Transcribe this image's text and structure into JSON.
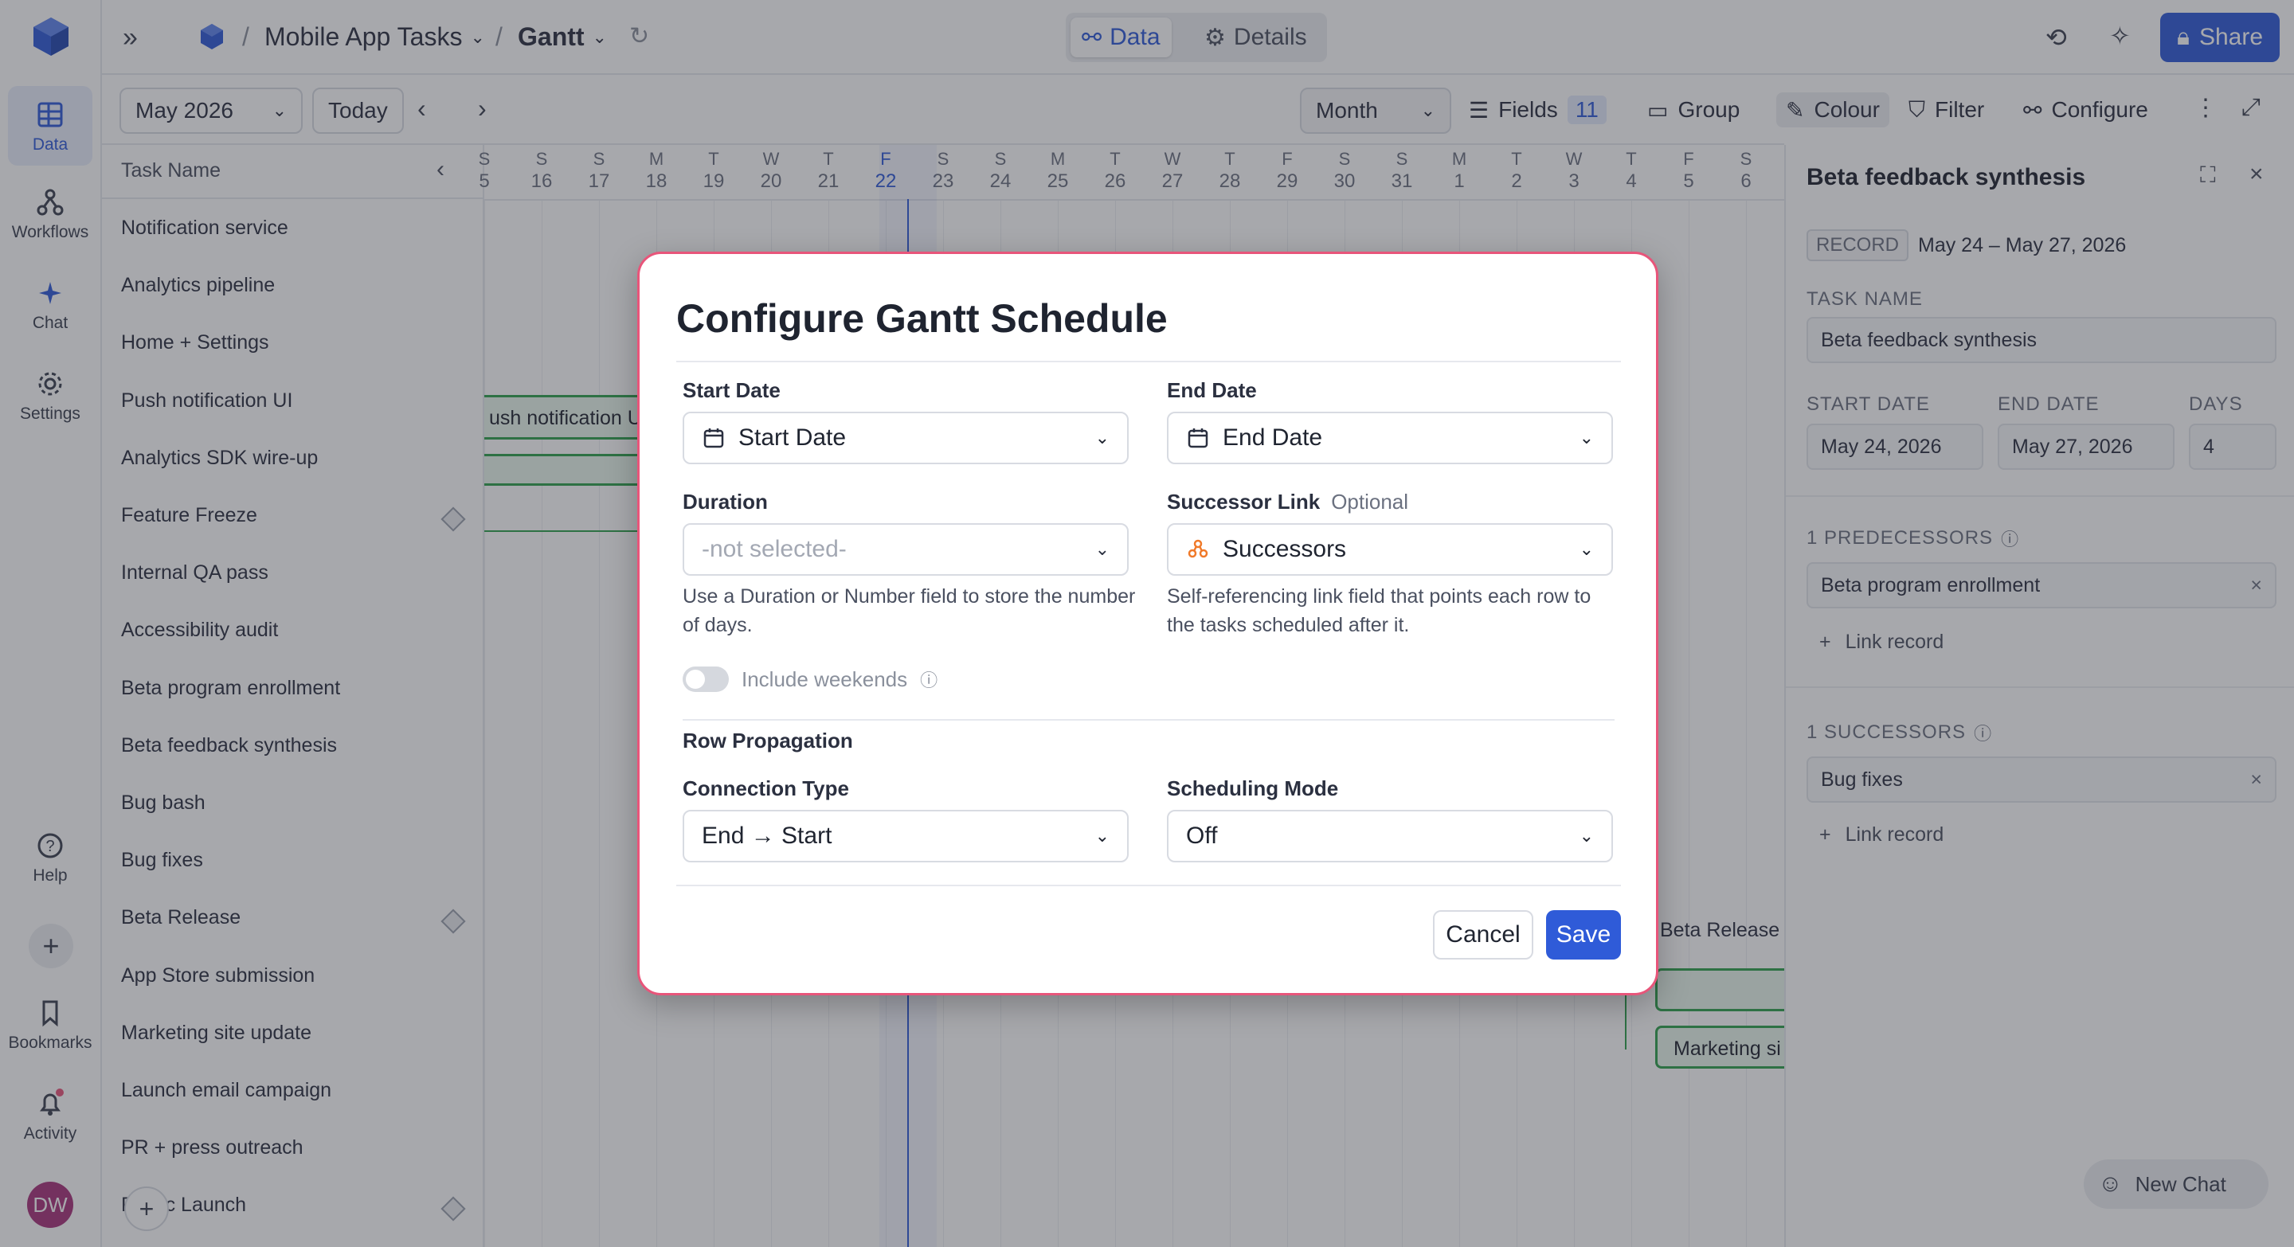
{
  "rail": {
    "items": [
      {
        "label": "Data",
        "icon": "grid-icon"
      },
      {
        "label": "Workflows",
        "icon": "workflow-icon"
      },
      {
        "label": "Chat",
        "icon": "sparkle-icon"
      },
      {
        "label": "Settings",
        "icon": "gear-icon"
      },
      {
        "label": "Help",
        "icon": "help-icon"
      },
      {
        "label": "Bookmarks",
        "icon": "bookmark-icon"
      },
      {
        "label": "Activity",
        "icon": "bell-icon"
      }
    ],
    "avatar": "DW"
  },
  "header": {
    "base_name": "Mobile App Tasks",
    "view_name": "Gantt",
    "tabs": [
      "Data",
      "Details"
    ],
    "share_label": "Share"
  },
  "toolbar": {
    "month": "May 2026",
    "today": "Today",
    "scale": "Month",
    "fields_label": "Fields",
    "fields_count": "11",
    "group": "Group",
    "colour": "Colour",
    "filter": "Filter",
    "configure": "Configure"
  },
  "grid": {
    "column_header": "Task Name",
    "days": [
      {
        "w": "S",
        "d": "5"
      },
      {
        "w": "S",
        "d": "16"
      },
      {
        "w": "S",
        "d": "17"
      },
      {
        "w": "M",
        "d": "18"
      },
      {
        "w": "T",
        "d": "19"
      },
      {
        "w": "W",
        "d": "20"
      },
      {
        "w": "T",
        "d": "21"
      },
      {
        "w": "F",
        "d": "22"
      },
      {
        "w": "S",
        "d": "23"
      },
      {
        "w": "S",
        "d": "24"
      },
      {
        "w": "M",
        "d": "25"
      },
      {
        "w": "T",
        "d": "26"
      },
      {
        "w": "W",
        "d": "27"
      },
      {
        "w": "T",
        "d": "28"
      },
      {
        "w": "F",
        "d": "29"
      },
      {
        "w": "S",
        "d": "30"
      },
      {
        "w": "S",
        "d": "31"
      },
      {
        "w": "M",
        "d": "1"
      },
      {
        "w": "T",
        "d": "2"
      },
      {
        "w": "W",
        "d": "3"
      },
      {
        "w": "T",
        "d": "4"
      },
      {
        "w": "F",
        "d": "5"
      },
      {
        "w": "S",
        "d": "6"
      }
    ],
    "tasks": [
      "Notification service",
      "Analytics pipeline",
      "Home + Settings",
      "Push notification UI",
      "Analytics SDK wire-up",
      "Feature Freeze",
      "Internal QA pass",
      "Accessibility audit",
      "Beta program enrollment",
      "Beta feedback synthesis",
      "Bug bash",
      "Bug fixes",
      "Beta Release",
      "App Store submission",
      "Marketing site update",
      "Launch email campaign",
      "PR + press outreach",
      "Public Launch"
    ],
    "bar_labels": [
      "ush notification U",
      "Beta Release",
      "Marketing si"
    ],
    "new_chat": "New Chat"
  },
  "panel": {
    "title": "Beta feedback synthesis",
    "record_tag": "RECORD",
    "record_range": "May 24 – May 27, 2026",
    "task_name_label": "TASK NAME",
    "task_name": "Beta feedback synthesis",
    "start_label": "START DATE",
    "start_value": "May 24, 2026",
    "end_label": "END DATE",
    "end_value": "May 27, 2026",
    "days_label": "DAYS",
    "days_value": "4",
    "pred_label": "1 PREDECESSORS",
    "pred_value": "Beta program enrollment",
    "link_record": "Link record",
    "succ_label": "1 SUCCESSORS",
    "succ_value": "Bug fixes"
  },
  "modal": {
    "title": "Configure Gantt Schedule",
    "start_label": "Start Date",
    "start_value": "Start Date",
    "end_label": "End Date",
    "end_value": "End Date",
    "duration_label": "Duration",
    "duration_value": "-not selected-",
    "duration_hint": "Use a Duration or Number field to store the number of days.",
    "successor_label": "Successor Link",
    "successor_optional": "Optional",
    "successor_value": "Successors",
    "successor_hint": "Self-referencing link field that points each row to the tasks scheduled after it.",
    "weekends_label": "Include weekends",
    "row_propagation": "Row Propagation",
    "connection_label": "Connection Type",
    "connection_value": "End → Start",
    "scheduling_label": "Scheduling Mode",
    "scheduling_value": "Off",
    "cancel": "Cancel",
    "save": "Save"
  }
}
